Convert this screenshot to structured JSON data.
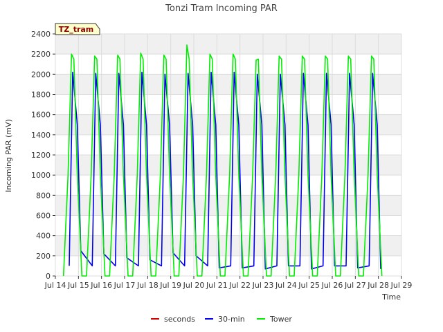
{
  "chart_data": {
    "type": "line",
    "title": "Tonzi Tram Incoming PAR",
    "xlabel": "Time",
    "ylabel": "Incoming PAR (mV)",
    "badge": "TZ_tram",
    "ylim": [
      0,
      2400
    ],
    "xlim": [
      14,
      29
    ],
    "y_ticks": [
      0,
      200,
      400,
      600,
      800,
      1000,
      1200,
      1400,
      1600,
      1800,
      2000,
      2200,
      2400
    ],
    "x_ticks": [
      {
        "v": 14,
        "label": "Jul 14"
      },
      {
        "v": 15,
        "label": "Jul 15"
      },
      {
        "v": 16,
        "label": "Jul 16"
      },
      {
        "v": 17,
        "label": "Jul 17"
      },
      {
        "v": 18,
        "label": "Jul 18"
      },
      {
        "v": 19,
        "label": "Jul 19"
      },
      {
        "v": 20,
        "label": "Jul 20"
      },
      {
        "v": 21,
        "label": "Jul 21"
      },
      {
        "v": 22,
        "label": "Jul 22"
      },
      {
        "v": 23,
        "label": "Jul 23"
      },
      {
        "v": 24,
        "label": "Jul 24"
      },
      {
        "v": 25,
        "label": "Jul 25"
      },
      {
        "v": 26,
        "label": "Jul 26"
      },
      {
        "v": 27,
        "label": "Jul 27"
      },
      {
        "v": 28,
        "label": "Jul 28"
      },
      {
        "v": 29,
        "label": "Jul 29"
      }
    ],
    "grid": true,
    "legend_position": "bottom",
    "series": [
      {
        "name": "seconds",
        "color": "#cc0000",
        "x": [],
        "y": []
      },
      {
        "name": "30-min",
        "color": "#0000ee",
        "x": [
          14.6,
          14.75,
          14.95,
          15.1,
          15.6,
          15.75,
          15.95,
          16.1,
          16.6,
          16.75,
          16.95,
          17.1,
          17.6,
          17.75,
          17.95,
          18.1,
          18.6,
          18.75,
          18.95,
          19.1,
          19.6,
          19.75,
          19.95,
          20.1,
          20.6,
          20.75,
          20.95,
          21.1,
          21.6,
          21.75,
          21.95,
          22.1,
          22.6,
          22.75,
          22.95,
          23.1,
          23.6,
          23.75,
          23.95,
          24.1,
          24.6,
          24.75,
          24.95,
          25.1,
          25.6,
          25.75,
          25.95,
          26.1,
          26.6,
          26.75,
          26.95,
          27.1,
          27.6,
          27.75,
          27.95,
          28.1
        ],
        "y": [
          100,
          2020,
          1500,
          250,
          100,
          2010,
          1500,
          220,
          100,
          2010,
          1500,
          180,
          100,
          2020,
          1500,
          160,
          100,
          2000,
          1500,
          230,
          100,
          2010,
          1500,
          200,
          100,
          2020,
          1500,
          80,
          100,
          2020,
          1500,
          80,
          100,
          2000,
          1500,
          70,
          100,
          2000,
          1500,
          100,
          100,
          2010,
          1500,
          70,
          100,
          2010,
          1500,
          100,
          100,
          2010,
          1500,
          80,
          100,
          2010,
          1500,
          70
        ]
      },
      {
        "name": "Tower",
        "color": "#00ee00",
        "x": [
          14.35,
          14.55,
          14.7,
          14.8,
          14.95,
          15.15,
          15.35,
          15.55,
          15.7,
          15.8,
          15.95,
          16.15,
          16.35,
          16.55,
          16.7,
          16.8,
          16.95,
          17.15,
          17.35,
          17.55,
          17.7,
          17.8,
          17.95,
          18.15,
          18.35,
          18.55,
          18.7,
          18.8,
          18.95,
          19.15,
          19.35,
          19.55,
          19.7,
          19.8,
          19.95,
          20.15,
          20.35,
          20.55,
          20.7,
          20.8,
          20.95,
          21.15,
          21.35,
          21.55,
          21.7,
          21.8,
          21.95,
          22.15,
          22.35,
          22.55,
          22.7,
          22.8,
          22.95,
          23.15,
          23.35,
          23.55,
          23.7,
          23.8,
          23.95,
          24.15,
          24.35,
          24.55,
          24.7,
          24.8,
          24.95,
          25.15,
          25.35,
          25.55,
          25.7,
          25.8,
          25.95,
          26.15,
          26.35,
          26.55,
          26.7,
          26.8,
          26.95,
          27.15,
          27.35,
          27.55,
          27.7,
          27.8,
          27.95,
          28.15
        ],
        "y": [
          0,
          1000,
          2200,
          2150,
          1000,
          0,
          0,
          1000,
          2180,
          2150,
          1000,
          0,
          0,
          1000,
          2190,
          2150,
          1000,
          0,
          0,
          1000,
          2210,
          2150,
          1000,
          0,
          0,
          1000,
          2190,
          2150,
          1000,
          0,
          0,
          1000,
          2290,
          2150,
          1000,
          0,
          0,
          1000,
          2200,
          2150,
          1000,
          0,
          0,
          1000,
          2200,
          2150,
          1000,
          0,
          0,
          1000,
          2140,
          2150,
          1000,
          0,
          0,
          1000,
          2180,
          2150,
          1000,
          0,
          0,
          1000,
          2180,
          2150,
          1000,
          0,
          0,
          1000,
          2180,
          2150,
          1000,
          0,
          0,
          1000,
          2180,
          2150,
          1000,
          0,
          0,
          1000,
          2180,
          2150,
          1000,
          0
        ]
      }
    ]
  }
}
